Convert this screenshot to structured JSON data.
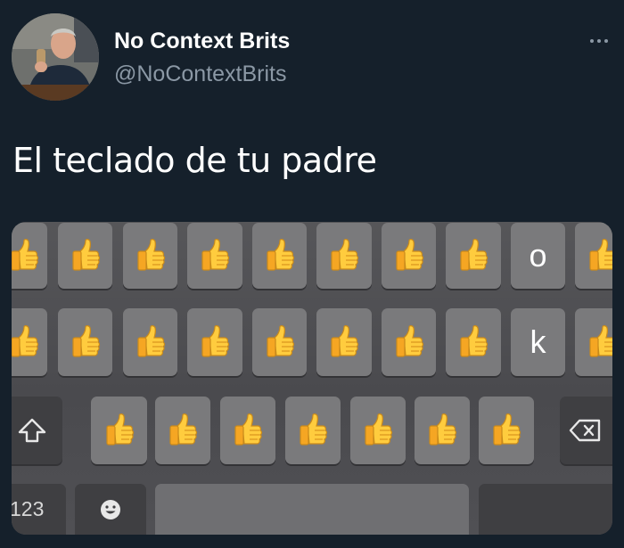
{
  "tweet": {
    "display_name": "No Context Brits",
    "handle": "@NoContextBrits",
    "text": "El teclado de tu padre"
  },
  "keyboard": {
    "row1_letter": "o",
    "row2_letter": "k",
    "numbers_label": "123",
    "icons": {
      "shift": "shift-icon",
      "delete": "delete-icon",
      "emoji": "emoji-icon",
      "thumb": "thumbs-up-icon"
    }
  },
  "colors": {
    "background": "#15202b",
    "secondary_text": "#8b98a5",
    "thumb_yellow": "#ffcc3e"
  }
}
